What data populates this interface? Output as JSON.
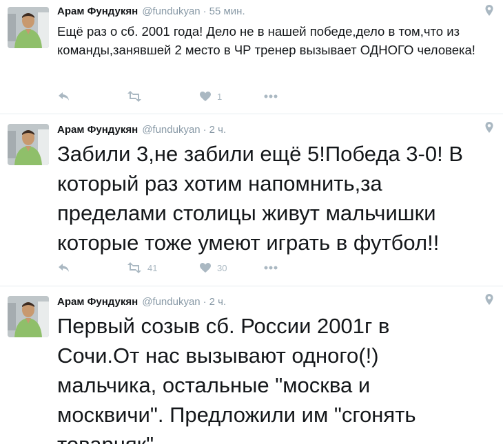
{
  "tweets": [
    {
      "name": "Арам Фундукян",
      "handle": "@fundukyan",
      "time": "55 мин.",
      "text": "Ещё раз о сб. 2001 года! Дело не в нашей победе,дело в том,что из команды,занявшей 2 место в ЧР тренер вызывает ОДНОГО человека!",
      "retweets": "",
      "likes": "1"
    },
    {
      "name": "Арам Фундукян",
      "handle": "@fundukyan",
      "time": "2 ч.",
      "text": "Забили 3,не забили ещё 5!Победа 3-0! В который раз хотим напомнить,за пределами столицы живут мальчишки которые тоже умеют играть в футбол!!",
      "retweets": "41",
      "likes": "30"
    },
    {
      "name": "Арам Фундукян",
      "handle": "@fundukyan",
      "time": "2 ч.",
      "text": "Первый созыв сб. России 2001г в Сочи.От нас вызывают одного(!) мальчика, остальные \"москва и москвичи\". Предложили им \"сгонять товарняк\""
    }
  ],
  "icons": {
    "reply": "reply-icon",
    "retweet": "retweet-icon",
    "like": "heart-icon",
    "more": "more-icon",
    "geo": "location-pin-icon"
  },
  "colors": {
    "text": "#14171a",
    "muted": "#8899a6",
    "icon": "#aab8c2",
    "divider": "#e6ecf0"
  }
}
